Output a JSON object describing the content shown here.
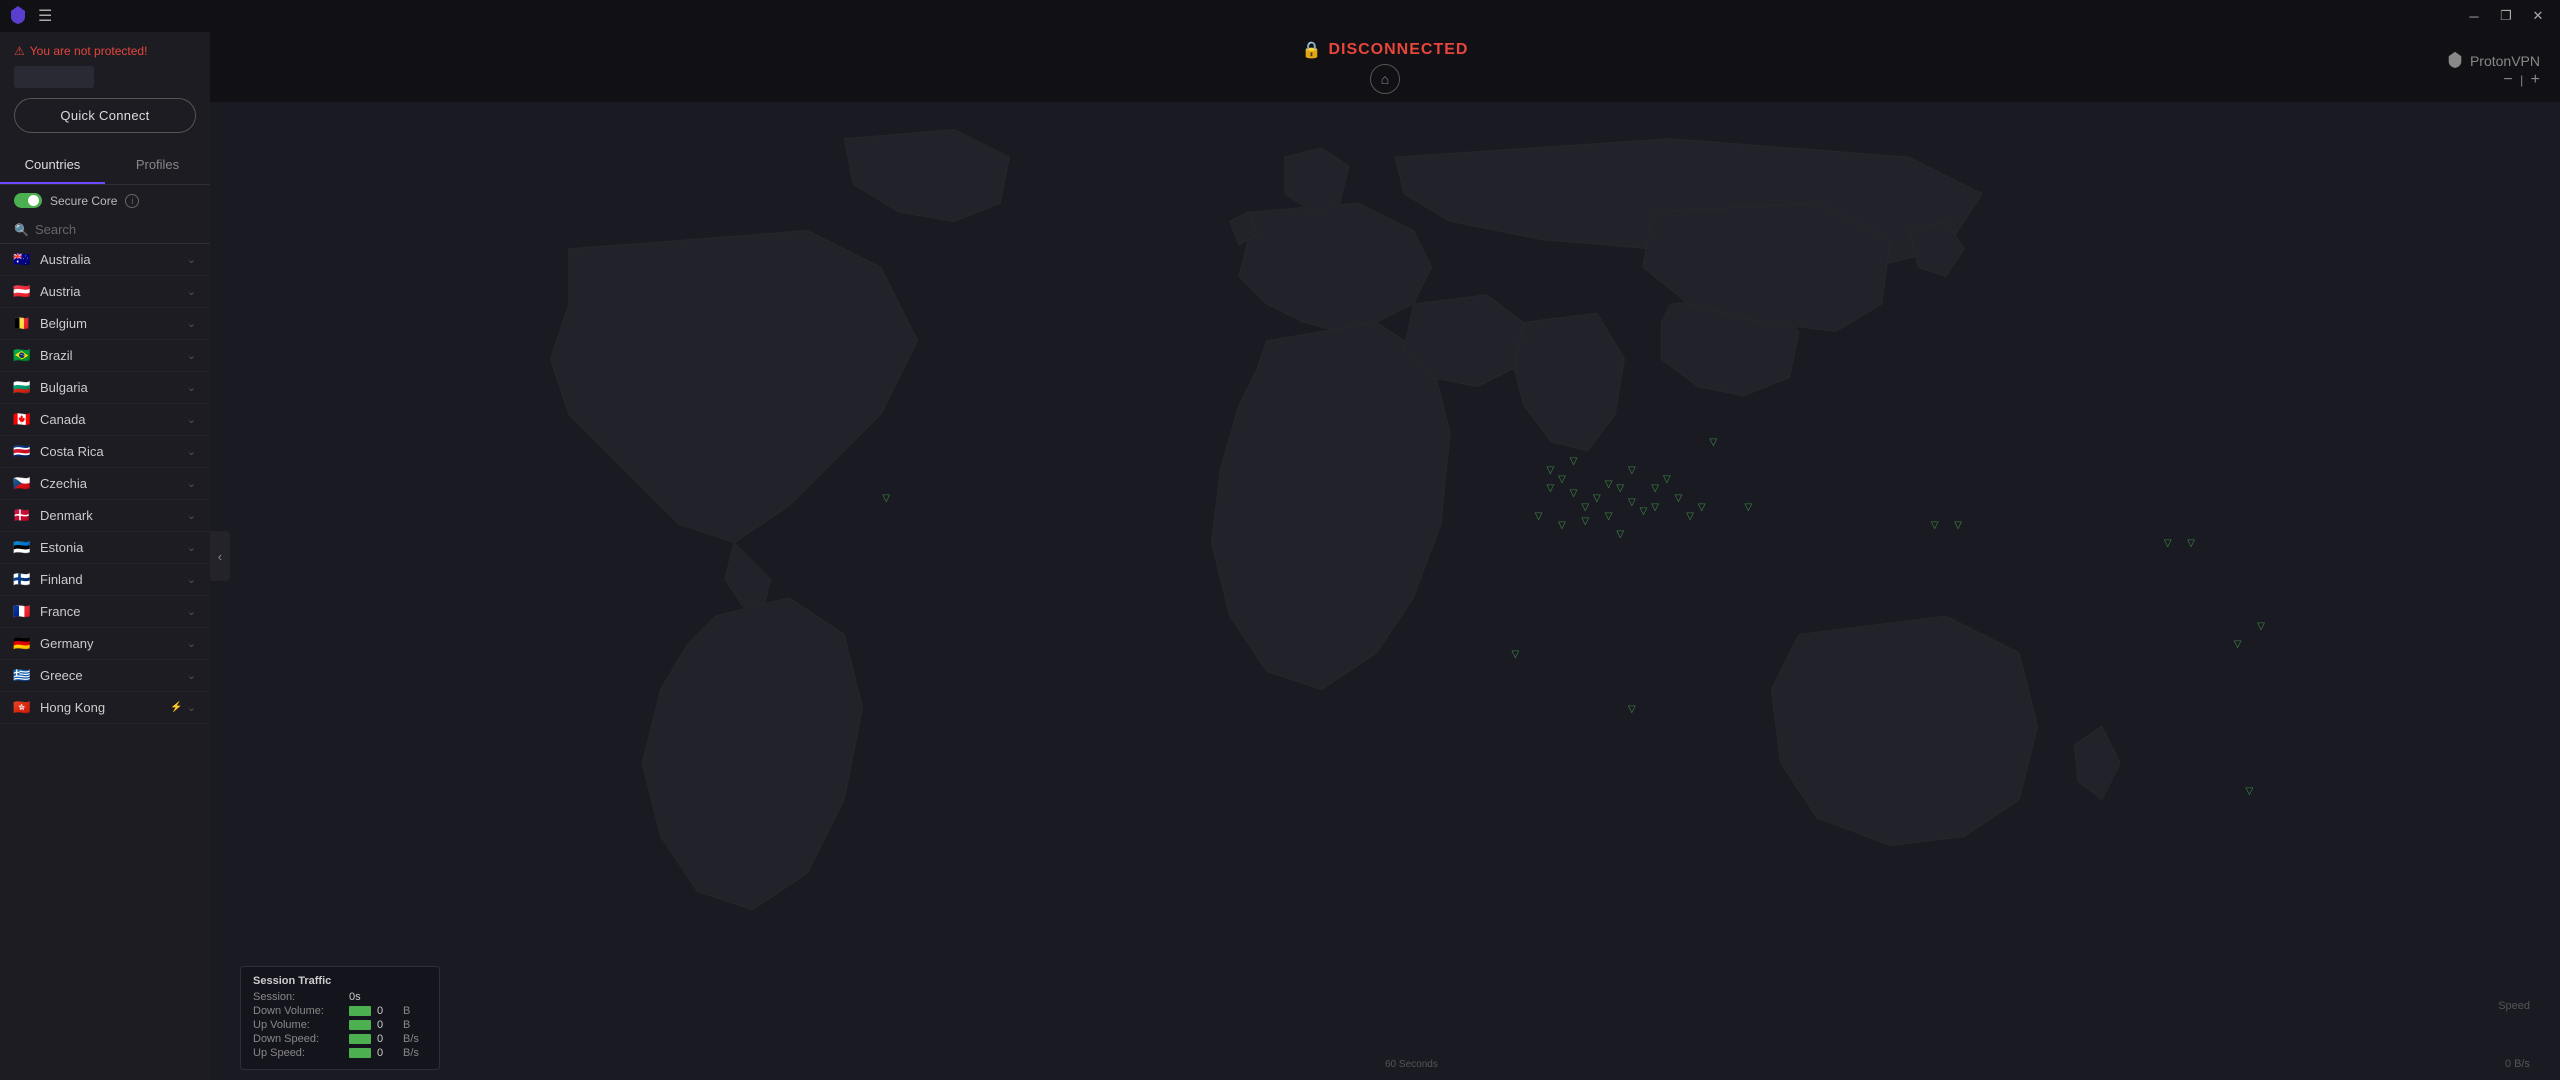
{
  "titlebar": {
    "minimize_label": "─",
    "restore_label": "❐",
    "close_label": "✕"
  },
  "warning": {
    "text": "You are not protected!"
  },
  "quick_connect": {
    "label": "Quick Connect"
  },
  "tabs": {
    "countries_label": "Countries",
    "profiles_label": "Profiles"
  },
  "secure_core": {
    "label": "Secure Core",
    "info": "i"
  },
  "search": {
    "placeholder": "Search"
  },
  "countries": [
    {
      "name": "Australia",
      "flag": "🇦🇺"
    },
    {
      "name": "Austria",
      "flag": "🇦🇹"
    },
    {
      "name": "Belgium",
      "flag": "🇧🇪"
    },
    {
      "name": "Brazil",
      "flag": "🇧🇷"
    },
    {
      "name": "Bulgaria",
      "flag": "🇧🇬"
    },
    {
      "name": "Canada",
      "flag": "🇨🇦"
    },
    {
      "name": "Costa Rica",
      "flag": "🇨🇷"
    },
    {
      "name": "Czechia",
      "flag": "🇨🇿"
    },
    {
      "name": "Denmark",
      "flag": "🇩🇰"
    },
    {
      "name": "Estonia",
      "flag": "🇪🇪"
    },
    {
      "name": "Finland",
      "flag": "🇫🇮"
    },
    {
      "name": "France",
      "flag": "🇫🇷"
    },
    {
      "name": "Germany",
      "flag": "🇩🇪"
    },
    {
      "name": "Greece",
      "flag": "🇬🇷"
    },
    {
      "name": "Hong Kong",
      "flag": "🇭🇰"
    }
  ],
  "map": {
    "status": "DISCONNECTED",
    "logo": "ProtonVPN",
    "zoom_minus": "−",
    "zoom_bar": "|",
    "zoom_plus": "+",
    "speed_label": "Speed",
    "speed_value": "0 B/s",
    "time_label": "60 Seconds"
  },
  "session_traffic": {
    "title": "Session Traffic",
    "session_label": "Session:",
    "session_value": "0s",
    "down_volume_label": "Down Volume:",
    "down_volume_value": "0",
    "down_volume_unit": "B",
    "up_volume_label": "Up Volume:",
    "up_volume_value": "0",
    "up_volume_unit": "B",
    "down_speed_label": "Down Speed:",
    "down_speed_value": "0",
    "down_speed_unit": "B/s",
    "up_speed_label": "Up Speed:",
    "up_speed_value": "0",
    "up_speed_unit": "B/s"
  },
  "markers": [
    {
      "x": 28,
      "y": 42
    },
    {
      "x": 56,
      "y": 44
    },
    {
      "x": 56.5,
      "y": 41
    },
    {
      "x": 57,
      "y": 40
    },
    {
      "x": 57.5,
      "y": 41.5
    },
    {
      "x": 58,
      "y": 43
    },
    {
      "x": 58.5,
      "y": 42
    },
    {
      "x": 59,
      "y": 40.5
    },
    {
      "x": 59.5,
      "y": 41
    },
    {
      "x": 60,
      "y": 42.5
    },
    {
      "x": 60.5,
      "y": 43.5
    },
    {
      "x": 61,
      "y": 41
    },
    {
      "x": 61.5,
      "y": 40
    },
    {
      "x": 56.5,
      "y": 39
    },
    {
      "x": 57.5,
      "y": 38
    },
    {
      "x": 58,
      "y": 44.5
    },
    {
      "x": 59,
      "y": 44
    },
    {
      "x": 60,
      "y": 39
    },
    {
      "x": 61,
      "y": 43
    },
    {
      "x": 62,
      "y": 42
    },
    {
      "x": 63,
      "y": 43
    },
    {
      "x": 57,
      "y": 45
    },
    {
      "x": 59.5,
      "y": 46
    },
    {
      "x": 62.5,
      "y": 44
    },
    {
      "x": 63.5,
      "y": 36
    },
    {
      "x": 65,
      "y": 43
    },
    {
      "x": 73,
      "y": 45
    },
    {
      "x": 74,
      "y": 45
    },
    {
      "x": 83,
      "y": 47
    },
    {
      "x": 84,
      "y": 47
    },
    {
      "x": 86,
      "y": 58
    },
    {
      "x": 87,
      "y": 56
    },
    {
      "x": 55,
      "y": 59
    },
    {
      "x": 60,
      "y": 65
    },
    {
      "x": 86.5,
      "y": 74
    }
  ]
}
